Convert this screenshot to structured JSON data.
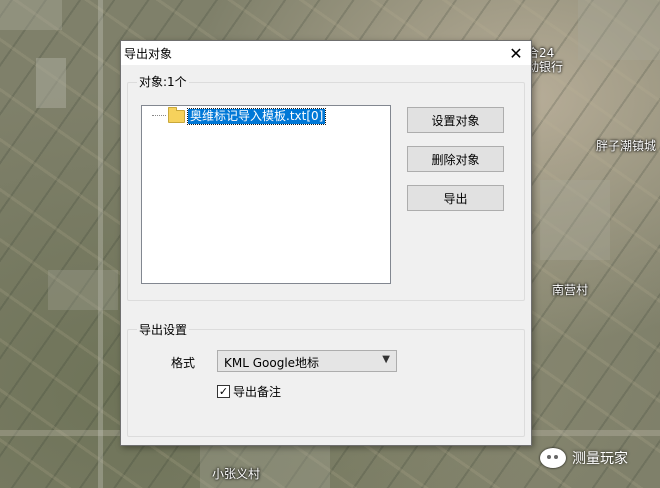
{
  "map": {
    "labels": [
      "合24",
      "动银行",
      "胖子潮镇城",
      "南营村",
      "小张义村"
    ]
  },
  "watermark": {
    "text": "测量玩家",
    "icon": "wechat-icon"
  },
  "dialog": {
    "title": "导出对象",
    "close_glyph": "✕",
    "objects_group": {
      "legend": "对象:1个",
      "items": [
        {
          "label": "奥维标记导入模板.txt[0]",
          "icon": "folder-icon"
        }
      ]
    },
    "buttons": {
      "set_object": "设置对象",
      "delete_object": "删除对象",
      "export": "导出"
    },
    "export_settings": {
      "legend": "导出设置",
      "format_label": "格式",
      "format_value": "KML Google地标",
      "remark_checked": true,
      "remark_label": "导出备注"
    }
  }
}
